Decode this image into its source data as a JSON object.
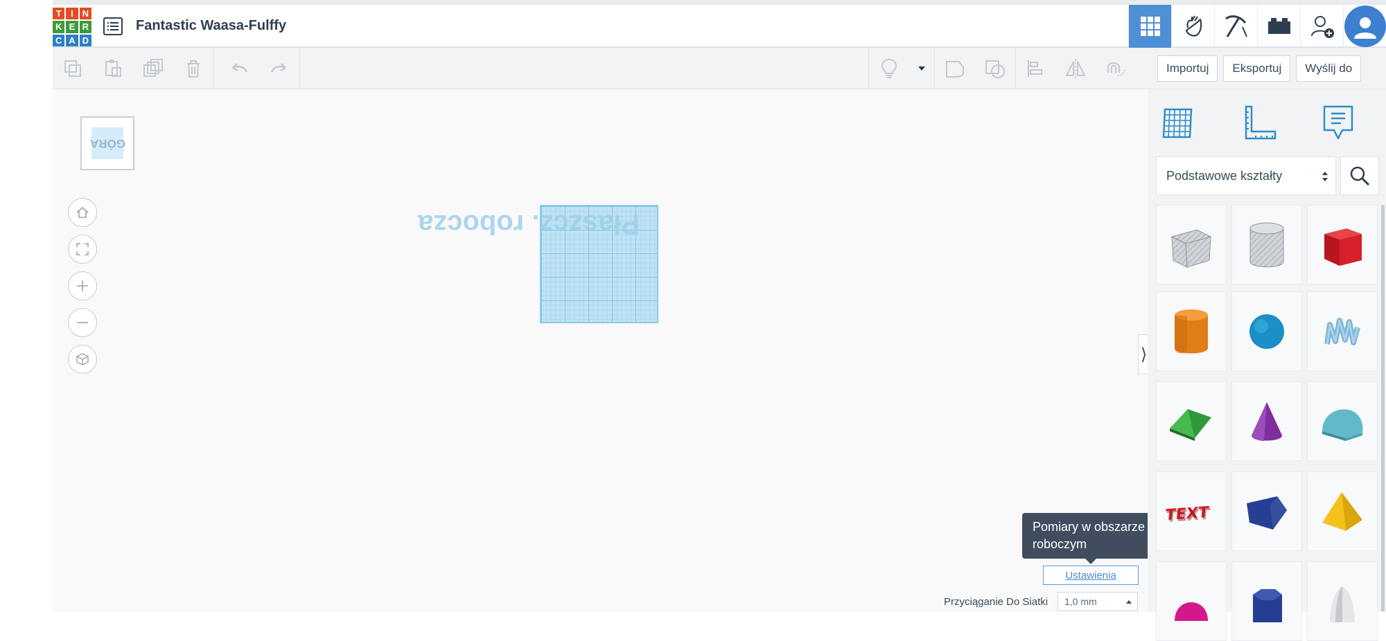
{
  "app": {
    "logo_letters": [
      "T",
      "I",
      "N",
      "K",
      "E",
      "R",
      "C",
      "A",
      "D"
    ],
    "logo_colors": [
      "#e24b26",
      "#e24b26",
      "#e24b26",
      "#3d9b3a",
      "#3d9b3a",
      "#3d9b3a",
      "#2d7fc6",
      "#2d7fc6",
      "#2d7fc6"
    ],
    "document_title": "Fantastic Waasa-Fulffy"
  },
  "header": {
    "icons": [
      "grid-view-icon",
      "hand-gestures-icon",
      "pickaxe-icon",
      "bricks-icon",
      "add-user-icon",
      "avatar-icon"
    ],
    "active_icon": "grid-view-icon",
    "accent_color": "#4f8fd6"
  },
  "toolbar": {
    "edit_tools": [
      "copy-icon",
      "paste-icon",
      "duplicate-icon",
      "delete-icon"
    ],
    "history_tools": [
      "undo-icon",
      "redo-icon"
    ],
    "shape_tools": [
      "lightbulb-icon",
      "dropdown-icon",
      "group-icon",
      "ungroup-icon",
      "align-icon",
      "mirror-icon",
      "magnet-icon"
    ],
    "import_label": "Importuj",
    "export_label": "Eksportuj",
    "send_label": "Wyślij do"
  },
  "workspace": {
    "viewcube_label": "GÓRA",
    "plane_label": "Płaszcz. robocza",
    "nav_controls": [
      "home-icon",
      "fit-view-icon",
      "zoom-in-icon",
      "zoom-out-icon",
      "perspective-icon"
    ],
    "tooltip_text": "Pomiary w obszarze roboczym",
    "settings_label": "Ustawienia",
    "snap_label": "Przyciąganie Do Siatki",
    "snap_value": "1,0 mm"
  },
  "panel": {
    "tabs": [
      "workplane-grid-icon",
      "ruler-icon",
      "notes-icon"
    ],
    "category": "Podstawowe kształty",
    "shapes": [
      "box-hole",
      "cylinder-hole",
      "box",
      "cylinder",
      "sphere",
      "scribble",
      "roof",
      "cone",
      "round-roof",
      "text",
      "wedge",
      "pyramid",
      "half-sphere",
      "polygon",
      "paraboloid"
    ]
  }
}
